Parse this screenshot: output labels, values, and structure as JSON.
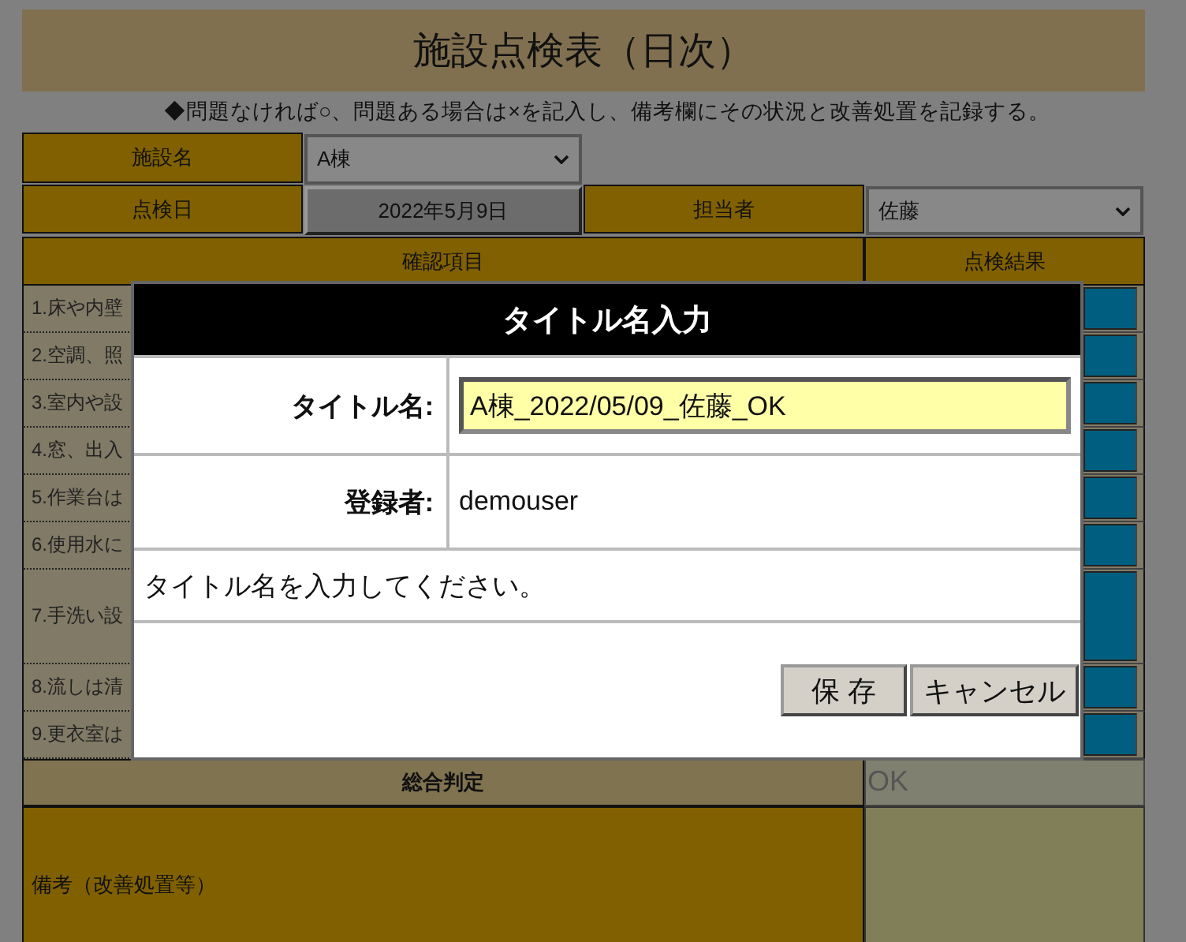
{
  "title": "施設点検表（日次）",
  "note": "◆問題なければ○、問題ある場合は×を記入し、備考欄にその状況と改善処置を記録する。",
  "facility": {
    "label": "施設名",
    "value": "A棟"
  },
  "inspection_date": {
    "label": "点検日",
    "value": "2022年5月9日"
  },
  "person": {
    "label": "担当者",
    "value": "佐藤"
  },
  "columns": [
    "確認項目",
    "点検結果"
  ],
  "items": [
    {
      "text": "1.床や内壁",
      "tall": false
    },
    {
      "text": "2.空調、照",
      "tall": false
    },
    {
      "text": "3.室内や設",
      "tall": false
    },
    {
      "text": "4.窓、出入",
      "tall": false
    },
    {
      "text": "5.作業台は",
      "tall": false
    },
    {
      "text": "6.使用水に",
      "tall": false
    },
    {
      "text": "7.手洗い設",
      "tall": true
    },
    {
      "text": "8.流しは清",
      "tall": false
    },
    {
      "text": "9.更衣室は",
      "tall": false
    }
  ],
  "overall": {
    "label": "総合判定",
    "value": "OK"
  },
  "remarks": {
    "label": "備考（改善処置等）"
  },
  "dialog": {
    "title": "タイトル名入力",
    "fields": [
      {
        "kind": "input",
        "label": "タイトル名:",
        "value": "A棟_2022/05/09_佐藤_OK"
      },
      {
        "kind": "text",
        "label": "登録者:",
        "value": "demouser"
      }
    ],
    "message": "タイトル名を入力してください。",
    "buttons": [
      "保 存",
      "キャンセル"
    ]
  }
}
